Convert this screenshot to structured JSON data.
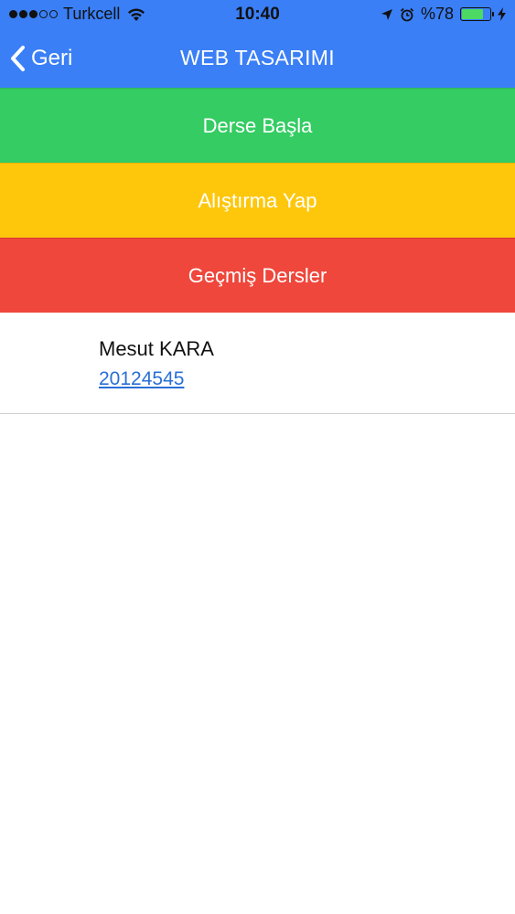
{
  "status_bar": {
    "signal_strength": "3 of 5",
    "carrier": "Turkcell",
    "time": "10:40",
    "battery_percent": "%78",
    "battery_level": 0.78,
    "icons": [
      "wifi-icon",
      "location-arrow-icon",
      "alarm-clock-icon",
      "battery-icon",
      "charging-bolt-icon"
    ]
  },
  "nav": {
    "back_label": "Geri",
    "title": "WEB TASARIMI",
    "background_color": "#3a7ff6"
  },
  "actions": [
    {
      "label": "Derse Başla",
      "color": "#34cc63"
    },
    {
      "label": "Alıştırma Yap",
      "color": "#fec70c"
    },
    {
      "label": "Geçmiş Dersler",
      "color": "#ef473c"
    }
  ],
  "user": {
    "name": "Mesut KARA",
    "id": "20124545"
  }
}
